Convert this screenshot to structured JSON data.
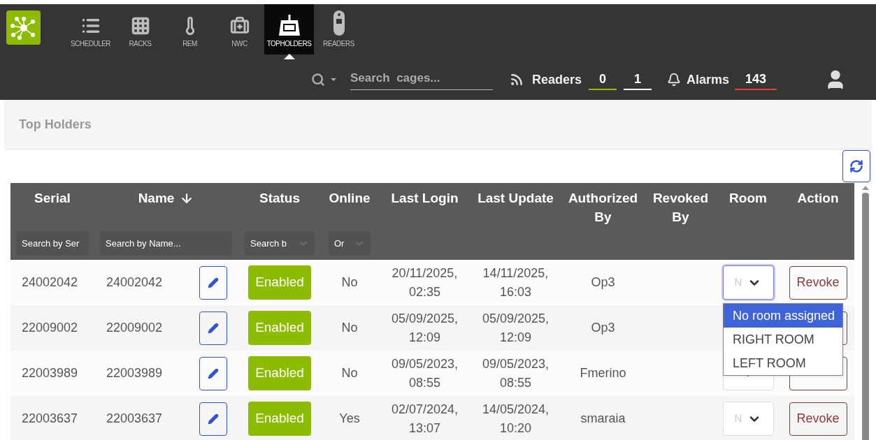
{
  "nav": {
    "items": [
      {
        "label": "SCHEDULER",
        "kind": "list",
        "selected": false
      },
      {
        "label": "RACKS",
        "kind": "grid",
        "selected": false
      },
      {
        "label": "REM",
        "kind": "thermometer",
        "selected": false
      },
      {
        "label": "NWC",
        "kind": "kit",
        "selected": false
      },
      {
        "label": "TOPHOLDERS",
        "kind": "topholder",
        "selected": true
      },
      {
        "label": "READERS",
        "kind": "reader",
        "selected": false
      }
    ]
  },
  "toolbar": {
    "search_placeholder": "Search  cages...",
    "readers_label": "Readers",
    "readers_counts": [
      {
        "value": "0",
        "color": "#9bbb00"
      },
      {
        "value": "1",
        "color": "#ffffff"
      }
    ],
    "alarms_label": "Alarms",
    "alarms_count": {
      "value": "143",
      "color": "#e0442b"
    }
  },
  "breadcrumb": "Top Holders",
  "table": {
    "columns": [
      {
        "label": "Serial",
        "placeholder": "Search by Ser",
        "kind": "text"
      },
      {
        "label": "Name",
        "sorted": true,
        "placeholder": "Search by Name...",
        "kind": "text"
      },
      {
        "label": "Status",
        "filter": "Search b",
        "kind": "select"
      },
      {
        "label": "Online",
        "filter": "Or",
        "kind": "select"
      },
      {
        "label": "Last  Login"
      },
      {
        "label": "Last Update"
      },
      {
        "label": "Authorized By"
      },
      {
        "label": "Revoked By"
      },
      {
        "label": "Room"
      },
      {
        "label": "Action"
      }
    ],
    "rows": [
      {
        "serial": "24002042",
        "name": "24002042",
        "status": "Enabled",
        "online": "No",
        "last_login": "20/11/2025, 02:35",
        "last_update": "14/11/2025, 16:03",
        "authorized_by": "Op3",
        "room": "N",
        "room_focused": true,
        "action": "Revoke"
      },
      {
        "serial": "22009002",
        "name": "22009002",
        "status": "Enabled",
        "online": "No",
        "last_login": "05/09/2025, 12:09",
        "last_update": "05/09/2025, 12:09",
        "authorized_by": "Op3",
        "room_focused": false
      },
      {
        "serial": "22003989",
        "name": "22003989",
        "status": "Enabled",
        "online": "No",
        "last_login": "09/05/2023, 08:55",
        "last_update": "09/05/2023, 08:55",
        "authorized_by": "Fmerino",
        "room_focused": false
      },
      {
        "serial": "22003637",
        "name": "22003637",
        "status": "Enabled",
        "online": "Yes",
        "last_login": "02/07/2024, 13:07",
        "last_update": "14/05/2024, 10:20",
        "authorized_by": "smaraia",
        "room": "N",
        "room_focused": false,
        "action": "Revoke"
      }
    ]
  },
  "room_dropdown": {
    "options": [
      {
        "label": "No room assigned",
        "selected": true
      },
      {
        "label": "RIGHT ROOM",
        "selected": false
      },
      {
        "label": "LEFT ROOM",
        "selected": false
      }
    ]
  }
}
